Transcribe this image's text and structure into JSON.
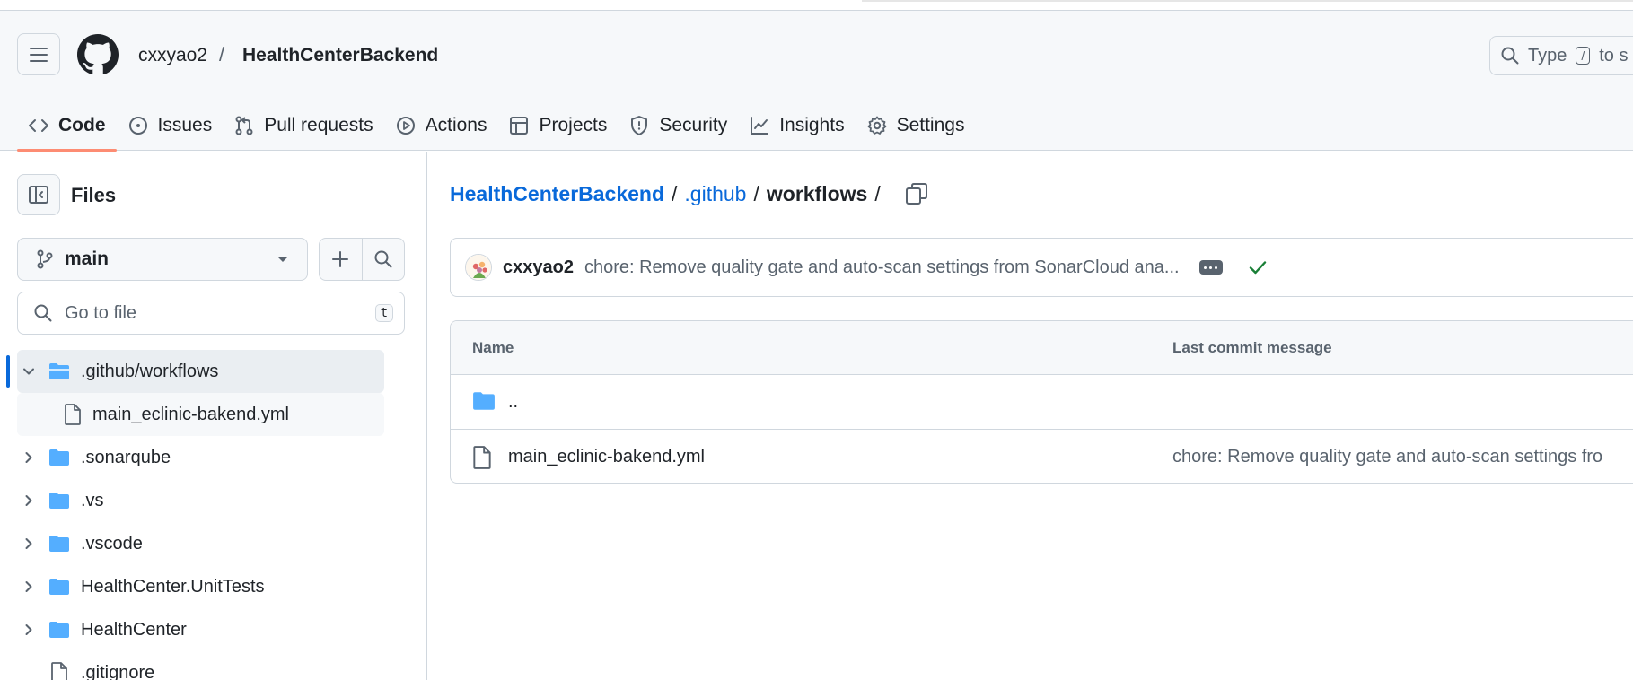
{
  "header": {
    "owner": "cxxyao2",
    "separator": "/",
    "repo": "HealthCenterBackend",
    "search_prefix": "Type",
    "search_key": "/",
    "search_suffix": "to s"
  },
  "nav": {
    "tabs": [
      {
        "label": "Code",
        "icon": "code-icon",
        "active": true
      },
      {
        "label": "Issues",
        "icon": "issue-icon"
      },
      {
        "label": "Pull requests",
        "icon": "pull-request-icon"
      },
      {
        "label": "Actions",
        "icon": "play-icon"
      },
      {
        "label": "Projects",
        "icon": "table-icon"
      },
      {
        "label": "Security",
        "icon": "shield-icon"
      },
      {
        "label": "Insights",
        "icon": "graph-icon"
      },
      {
        "label": "Settings",
        "icon": "gear-icon"
      }
    ]
  },
  "sidebar": {
    "title": "Files",
    "branch": "main",
    "goto_placeholder": "Go to file",
    "goto_key": "t",
    "tree": [
      {
        "label": ".github/workflows",
        "type": "folder",
        "expanded": true,
        "selected": true
      },
      {
        "label": "main_eclinic-bakend.yml",
        "type": "file",
        "child": true
      },
      {
        "label": ".sonarqube",
        "type": "folder"
      },
      {
        "label": ".vs",
        "type": "folder"
      },
      {
        "label": ".vscode",
        "type": "folder"
      },
      {
        "label": "HealthCenter.UnitTests",
        "type": "folder"
      },
      {
        "label": "HealthCenter",
        "type": "folder"
      },
      {
        "label": ".gitignore",
        "type": "file"
      }
    ]
  },
  "main": {
    "path": {
      "root": "HealthCenterBackend",
      "sep1": "/",
      "dir1": ".github",
      "sep2": "/",
      "current": "workflows",
      "sep3": "/"
    },
    "commit": {
      "user": "cxxyao2",
      "message": "chore: Remove quality gate and auto-scan settings from SonarCloud ana...",
      "status_color": "#1a7f37"
    },
    "table": {
      "col_name": "Name",
      "col_message": "Last commit message",
      "rows": [
        {
          "name": "..",
          "type": "folder",
          "message": ""
        },
        {
          "name": "main_eclinic-bakend.yml",
          "type": "file",
          "message": "chore: Remove quality gate and auto-scan settings fro"
        }
      ]
    }
  },
  "colors": {
    "accent": "#0969da",
    "folder": "#54aeff",
    "active_tab_underline": "#fd8c73"
  }
}
